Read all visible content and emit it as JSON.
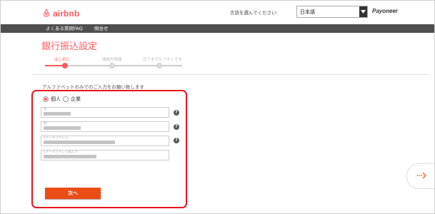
{
  "header": {
    "brand": "airbnb",
    "language_label": "言語を選んでください:",
    "language_value": "日本語",
    "partner": "Payoneer"
  },
  "nav": {
    "items": [
      "よくある質問FAQ",
      "問合せ"
    ]
  },
  "page": {
    "title": "銀行振込設定",
    "steps": [
      "はじめに",
      "連絡先情報",
      "完了までもうすぐです"
    ],
    "active_step": 1,
    "instruction": "アルファベットのみでのご入力をお願い致します"
  },
  "form": {
    "account_type_options": [
      "個人",
      "企業"
    ],
    "selected_account_type": "個人",
    "fields": [
      {
        "label": "名"
      },
      {
        "label": "姓"
      },
      {
        "label": "Eメールアドレス"
      },
      {
        "label": "Eメールアドレス再入力"
      }
    ],
    "help_symbol": "?",
    "next_label": "次へ",
    "highlight_color": "#e8131e"
  },
  "colors": {
    "brand": "#ff5a5f",
    "nav_bg": "#4f4f4f",
    "button": "#ea4c16"
  },
  "icons": {
    "logo": "airbnb-logo-icon",
    "dropdown": "chevron-down-icon",
    "side": "arrow-right-icon"
  }
}
